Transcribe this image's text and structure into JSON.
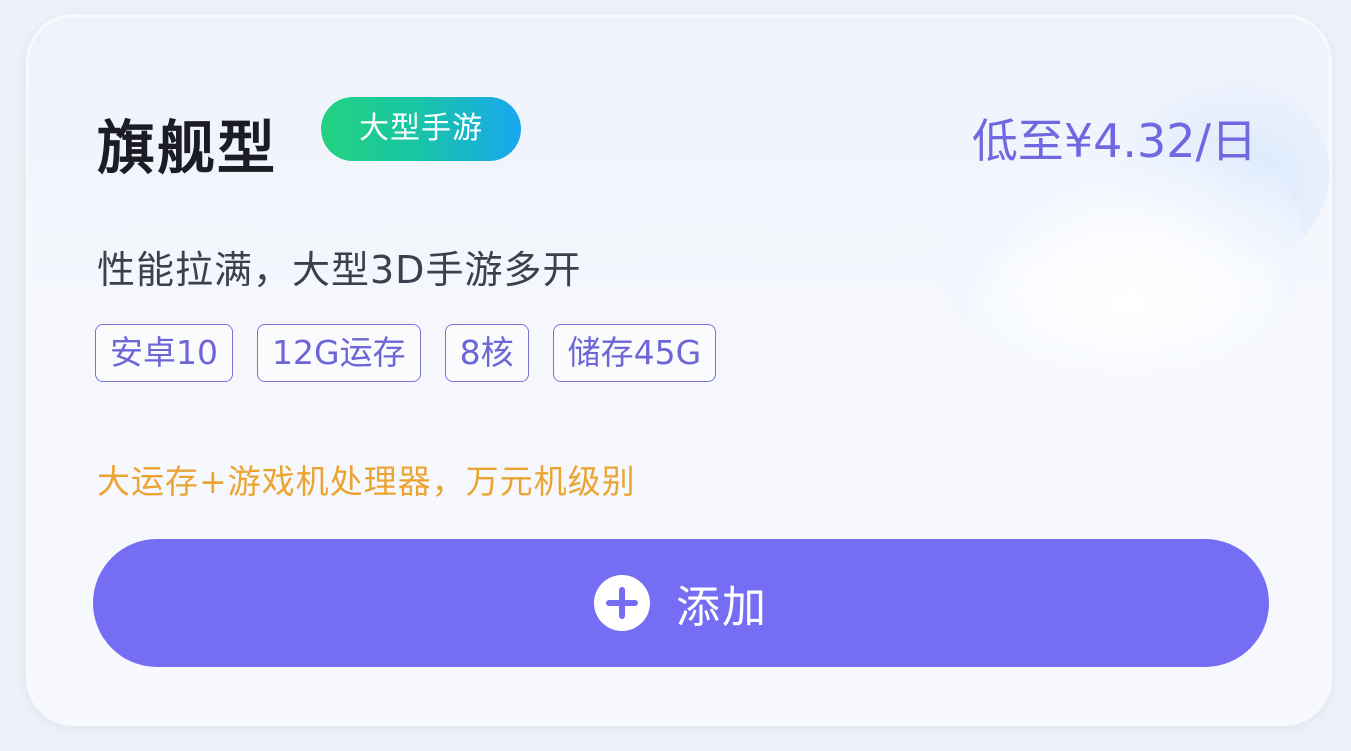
{
  "plan": {
    "title": "旗舰型",
    "tag": "大型手游",
    "price": "低至¥4.32/日",
    "description": "性能拉满，大型3D手游多开",
    "specs": [
      "安卓10",
      "12G运存",
      "8核",
      "储存45G"
    ],
    "highlight": "大运存+游戏机处理器，万元机级别",
    "button": {
      "label": "添加",
      "icon": "plus-circle-icon"
    }
  },
  "colors": {
    "accent": "#756df4",
    "price": "#7068e0",
    "highlight": "#eba431",
    "tag_gradient_start": "#22d37e",
    "tag_gradient_end": "#18a7f0"
  }
}
